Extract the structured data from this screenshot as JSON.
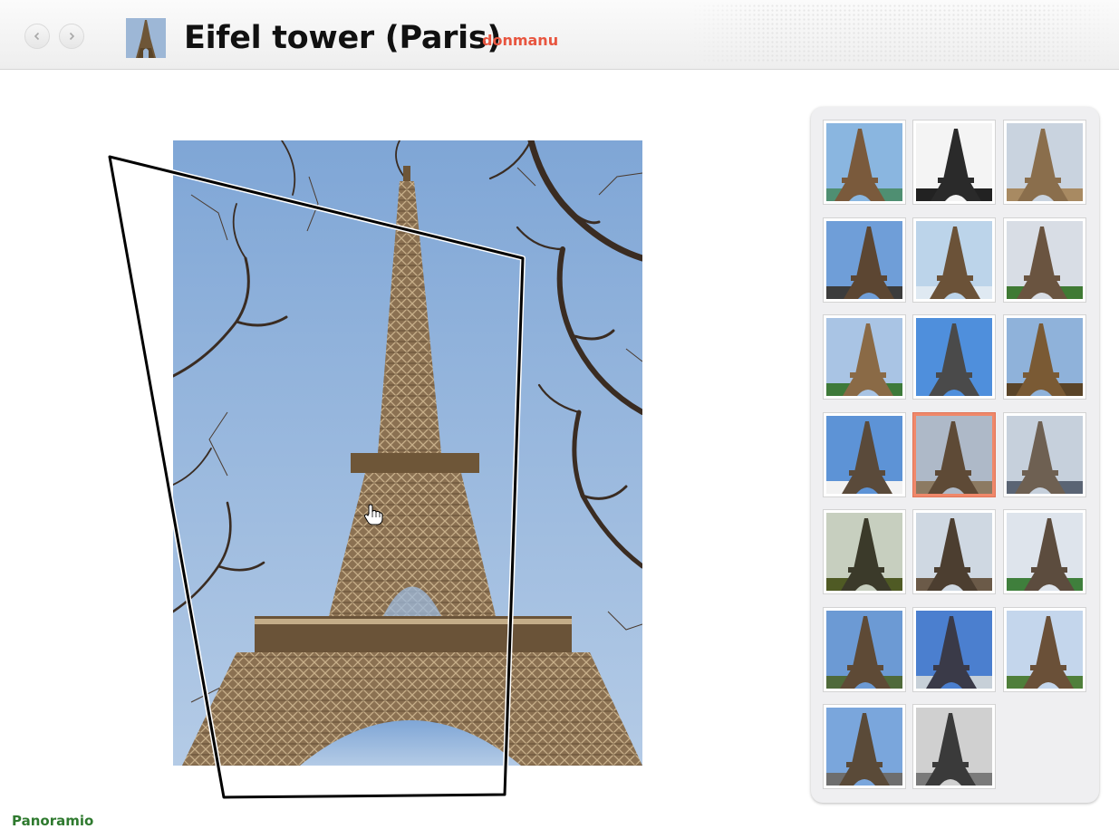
{
  "header": {
    "title": "Eifel tower (Paris)",
    "author": "donmanu",
    "prev_icon": "chevron-left-icon",
    "next_icon": "chevron-right-icon"
  },
  "footer": {
    "logo_text": "Panoramio"
  },
  "colors": {
    "author": "#e8553f",
    "selected_border": "#f0886a",
    "panel_background": "#efeff1",
    "logo": "#2f7a2f"
  },
  "thumbnails": [
    {
      "sky": "#8ab6e0",
      "tower": "#7a5a3c",
      "ground": "#4f8f72",
      "selected": false
    },
    {
      "sky": "#f4f4f4",
      "tower": "#2a2a2a",
      "ground": "#222222",
      "selected": false
    },
    {
      "sky": "#c9d3df",
      "tower": "#8a6e4c",
      "ground": "#a88a62",
      "selected": false
    },
    {
      "sky": "#6f9ed8",
      "tower": "#5c4632",
      "ground": "#3c3c3c",
      "selected": false
    },
    {
      "sky": "#bcd4ea",
      "tower": "#6b5238",
      "ground": "#dfe9f2",
      "selected": false
    },
    {
      "sky": "#d8dde5",
      "tower": "#6a5440",
      "ground": "#3f7a34",
      "selected": false
    },
    {
      "sky": "#a9c4e4",
      "tower": "#8a6a46",
      "ground": "#3e7a3a",
      "selected": false
    },
    {
      "sky": "#4f8fdc",
      "tower": "#4a4a4a",
      "ground": "#4f8fdc",
      "selected": false
    },
    {
      "sky": "#8fb2da",
      "tower": "#7a5a34",
      "ground": "#5a4428",
      "selected": false
    },
    {
      "sky": "#5d93d6",
      "tower": "#5a4a3a",
      "ground": "#f2f2f2",
      "selected": false
    },
    {
      "sky": "#aeb9c8",
      "tower": "#5e4a36",
      "ground": "#8c7a62",
      "selected": true
    },
    {
      "sky": "#c6d0dc",
      "tower": "#6e6052",
      "ground": "#5a6474",
      "selected": false
    },
    {
      "sky": "#c7cfbf",
      "tower": "#3b3a2a",
      "ground": "#4f5a24",
      "selected": false
    },
    {
      "sky": "#cfd8e2",
      "tower": "#4c3e30",
      "ground": "#6b5a48",
      "selected": false
    },
    {
      "sky": "#dee4ec",
      "tower": "#5c4c3e",
      "ground": "#3f7f3c",
      "selected": false
    },
    {
      "sky": "#6c9ad4",
      "tower": "#5e4a36",
      "ground": "#4f6a3a",
      "selected": false
    },
    {
      "sky": "#4b7fcf",
      "tower": "#3a3a48",
      "ground": "#c7d0d8",
      "selected": false
    },
    {
      "sky": "#c4d6ec",
      "tower": "#6a5038",
      "ground": "#4f7f3a",
      "selected": false
    },
    {
      "sky": "#7aa6dc",
      "tower": "#5a4a38",
      "ground": "#6e6e6e",
      "selected": false
    },
    {
      "sky": "#d0d0d0",
      "tower": "#3a3a3a",
      "ground": "#7a7a7a",
      "selected": false
    }
  ]
}
